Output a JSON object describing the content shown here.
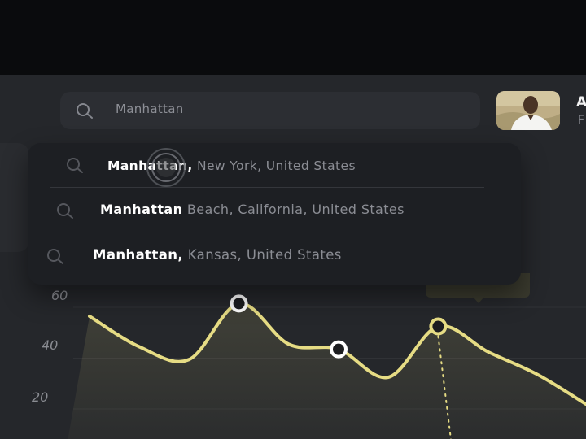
{
  "search": {
    "value": "Manhattan"
  },
  "profile": {
    "name_initial": "A",
    "subtitle_initial": "F"
  },
  "suggestions": [
    {
      "match": "Manhattan,",
      "rest": " New York, United States"
    },
    {
      "match": "Manhattan",
      "rest": " Beach, California, United States"
    },
    {
      "match": "Manhattan,",
      "rest": " Kansas, United States"
    }
  ],
  "chart_data": {
    "type": "area",
    "y_ticks": [
      "60",
      "40",
      "20"
    ],
    "ylim": [
      0,
      70
    ],
    "x": [
      0,
      1,
      2,
      3,
      4,
      5,
      6,
      7,
      8,
      9,
      10
    ],
    "series": [
      {
        "values": [
          52,
          40,
          35,
          57,
          41,
          39,
          28,
          48,
          38,
          29,
          17
        ]
      }
    ],
    "highlighted_points": [
      3,
      5,
      7
    ],
    "line_color": "#e6dc84",
    "marker_fill": "#1c1d20",
    "grid": true
  },
  "colors": {
    "panel": "#25272b",
    "dropdown": "#1d1f23",
    "accent": "#e6dc84"
  }
}
